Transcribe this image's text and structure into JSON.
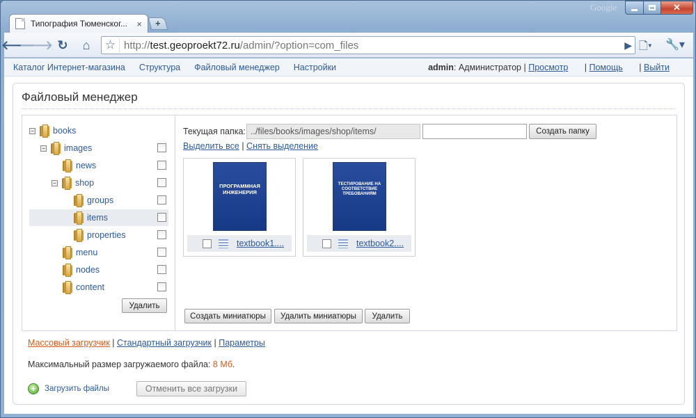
{
  "browser": {
    "tab_title": "Типография Тюменског...",
    "tab_close": "×",
    "new_tab": "+",
    "brand": "Google",
    "url_host": "test.geoproekt72.ru",
    "url_prefix": "http://",
    "url_path": "/admin/?option=com_files"
  },
  "topnav": {
    "items": [
      "Каталог Интернет-магазина",
      "Структура",
      "Файловый менеджер",
      "Настройки"
    ],
    "user_name": "admin",
    "user_role": ": Администратор | ",
    "view": "Просмотр",
    "help": "Помощь",
    "logout": "Выйти",
    "sep": " | "
  },
  "panel": {
    "title": "Файловый менеджер"
  },
  "tree": {
    "nodes": [
      {
        "label": "books",
        "expander": "−"
      },
      {
        "label": "images",
        "expander": "−"
      },
      {
        "label": "news"
      },
      {
        "label": "shop",
        "expander": "−"
      },
      {
        "label": "groups"
      },
      {
        "label": "items"
      },
      {
        "label": "properties"
      },
      {
        "label": "menu"
      },
      {
        "label": "nodes"
      },
      {
        "label": "content"
      }
    ],
    "delete_label": "Удалить"
  },
  "files": {
    "current_folder_label": "Текущая папка:",
    "current_folder_value": "../files/books/images/shop/items/",
    "new_folder_value": "",
    "create_folder_label": "Создать папку",
    "select_all": "Выделить все",
    "sep": " | ",
    "deselect": "Снять выделение",
    "items": [
      {
        "name": "textbook1....",
        "cover_title": "ПРОГРАММНАЯ ИНЖЕНЕРИЯ"
      },
      {
        "name": "textbook2....",
        "cover_title": "ТЕСТИРОВАНИЕ НА СООТВЕТСТВИЕ ТРЕБОВАНИЯМ"
      }
    ],
    "make_thumbs": "Создать миниатюры",
    "delete_thumbs": "Удалить миниатюры",
    "delete": "Удалить"
  },
  "upload": {
    "mass": "Массовый загрузчик",
    "standard": "Стандартный загрузчик",
    "params": "Параметры",
    "sep": " | ",
    "max_size_label": "Максимальный размер загружаемого файла: ",
    "max_size_value": "8 Мб",
    "max_size_end": ".",
    "upload_files": "Загрузить файлы",
    "cancel_all": "Отменить все загрузки"
  },
  "colors": {
    "link": "#2c5a9a",
    "accent": "#d15c19"
  }
}
